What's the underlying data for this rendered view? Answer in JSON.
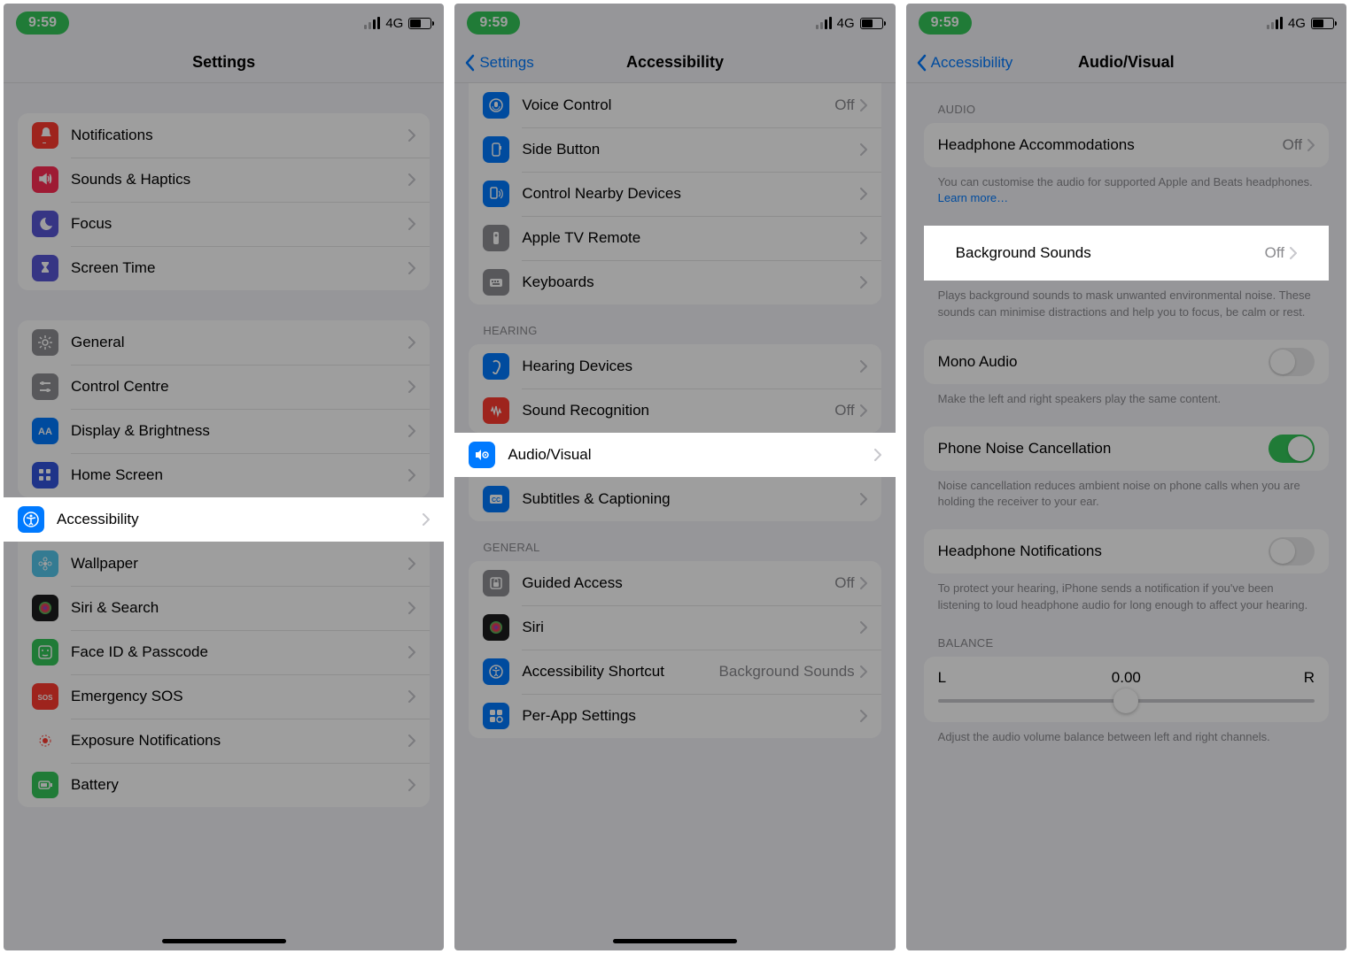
{
  "status": {
    "time": "9:59",
    "net": "4G"
  },
  "screen1": {
    "title": "Settings",
    "group1": [
      {
        "label": "Notifications",
        "color": "#ff3b30",
        "icon": "bell"
      },
      {
        "label": "Sounds & Haptics",
        "color": "#ff2d55",
        "icon": "speaker"
      },
      {
        "label": "Focus",
        "color": "#5856d6",
        "icon": "moon"
      },
      {
        "label": "Screen Time",
        "color": "#5856d6",
        "icon": "hourglass"
      }
    ],
    "group2": [
      {
        "label": "General",
        "color": "#8e8e93",
        "icon": "gear"
      },
      {
        "label": "Control Centre",
        "color": "#8e8e93",
        "icon": "sliders"
      },
      {
        "label": "Display & Brightness",
        "color": "#007aff",
        "icon": "aa"
      },
      {
        "label": "Home Screen",
        "color": "#3355dd",
        "icon": "grid"
      },
      {
        "label": "Accessibility",
        "color": "#007aff",
        "icon": "accessibility",
        "highlight": true
      },
      {
        "label": "Wallpaper",
        "color": "#54c7ec",
        "icon": "flower"
      },
      {
        "label": "Siri & Search",
        "color": "#1c1c1e",
        "icon": "siri"
      },
      {
        "label": "Face ID & Passcode",
        "color": "#34c759",
        "icon": "faceid"
      },
      {
        "label": "Emergency SOS",
        "color": "#ff3b30",
        "icon": "sos"
      },
      {
        "label": "Exposure Notifications",
        "color": "#ffffff",
        "icon": "exposure"
      },
      {
        "label": "Battery",
        "color": "#34c759",
        "icon": "battery"
      }
    ]
  },
  "screen2": {
    "back": "Settings",
    "title": "Accessibility",
    "group1": [
      {
        "label": "Voice Control",
        "value": "Off",
        "color": "#007aff",
        "icon": "voice"
      },
      {
        "label": "Side Button",
        "color": "#007aff",
        "icon": "side"
      },
      {
        "label": "Control Nearby Devices",
        "color": "#007aff",
        "icon": "nearby"
      },
      {
        "label": "Apple TV Remote",
        "color": "#8e8e93",
        "icon": "remote"
      },
      {
        "label": "Keyboards",
        "color": "#8e8e93",
        "icon": "keyboard"
      }
    ],
    "hearing_header": "HEARING",
    "group2": [
      {
        "label": "Hearing Devices",
        "color": "#007aff",
        "icon": "ear"
      },
      {
        "label": "Sound Recognition",
        "value": "Off",
        "color": "#ff3b30",
        "icon": "wave"
      },
      {
        "label": "Audio/Visual",
        "color": "#007aff",
        "icon": "audiovis",
        "highlight": true
      },
      {
        "label": "Subtitles & Captioning",
        "color": "#007aff",
        "icon": "cc"
      }
    ],
    "general_header": "GENERAL",
    "group3": [
      {
        "label": "Guided Access",
        "value": "Off",
        "color": "#8e8e93",
        "icon": "lock"
      },
      {
        "label": "Siri",
        "color": "#1c1c1e",
        "icon": "siri"
      },
      {
        "label": "Accessibility Shortcut",
        "value": "Background Sounds",
        "color": "#007aff",
        "icon": "shortcut"
      },
      {
        "label": "Per-App Settings",
        "color": "#007aff",
        "icon": "perapp"
      }
    ]
  },
  "screen3": {
    "back": "Accessibility",
    "title": "Audio/Visual",
    "audio_header": "AUDIO",
    "headphone_acc": {
      "label": "Headphone Accommodations",
      "value": "Off"
    },
    "headphone_footer": "You can customise the audio for supported Apple and Beats headphones.",
    "learn_more": "Learn more…",
    "bg_sounds": {
      "label": "Background Sounds",
      "value": "Off"
    },
    "bg_footer": "Plays background sounds to mask unwanted environmental noise. These sounds can minimise distractions and help you to focus, be calm or rest.",
    "mono": {
      "label": "Mono Audio"
    },
    "mono_footer": "Make the left and right speakers play the same content.",
    "noise": {
      "label": "Phone Noise Cancellation"
    },
    "noise_footer": "Noise cancellation reduces ambient noise on phone calls when you are holding the receiver to your ear.",
    "hp_notif": {
      "label": "Headphone Notifications"
    },
    "hp_notif_footer": "To protect your hearing, iPhone sends a notification if you've been listening to loud headphone audio for long enough to affect your hearing.",
    "balance_header": "BALANCE",
    "balance": {
      "left": "L",
      "center": "0.00",
      "right": "R"
    },
    "balance_footer": "Adjust the audio volume balance between left and right channels."
  }
}
